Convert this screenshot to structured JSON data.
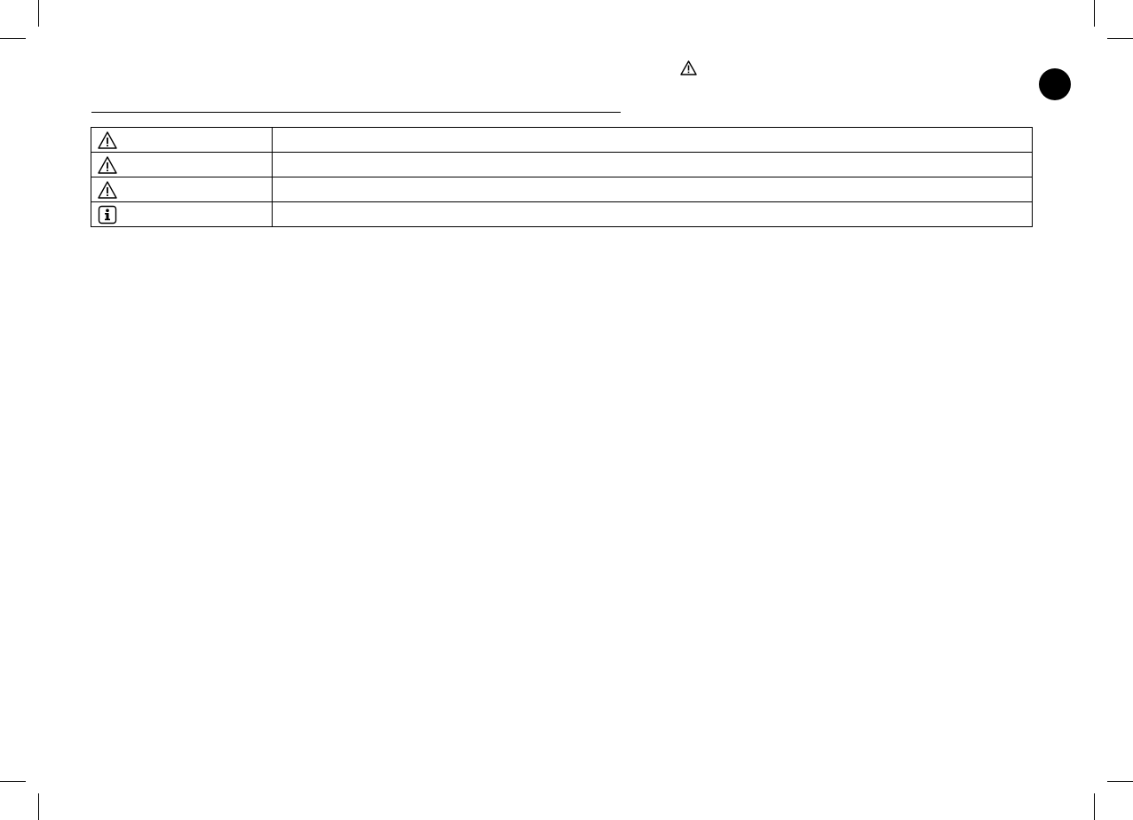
{
  "header": {
    "warning_icon": "warning-triangle-icon",
    "page_marker_color": "#000000"
  },
  "legend_table": {
    "rows": [
      {
        "icon": "warning-triangle-icon",
        "text": ""
      },
      {
        "icon": "warning-triangle-icon",
        "text": ""
      },
      {
        "icon": "warning-triangle-icon",
        "text": ""
      },
      {
        "icon": "information-icon",
        "text": ""
      }
    ]
  }
}
